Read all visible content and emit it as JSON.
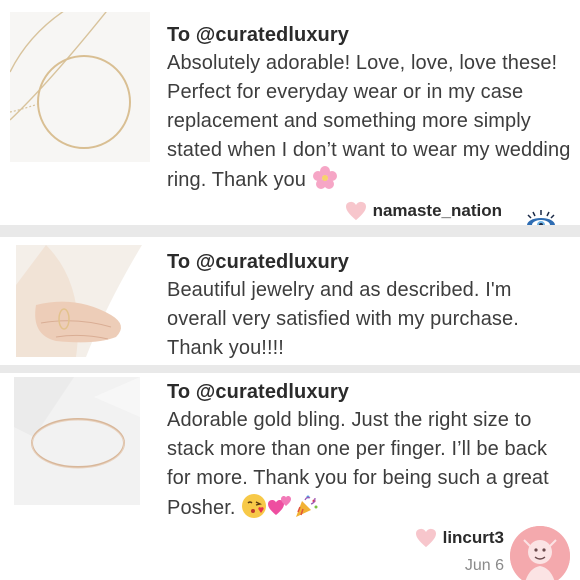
{
  "reviews": [
    {
      "to": "To @curatedluxury",
      "message": "Absolutely adorable! Love, love, love these! Perfect for everyday wear or in my case replacement and something more simply stated when I don’t want to wear my wedding ring. Thank you",
      "emoji_icons": [
        "cherry-blossom-icon"
      ],
      "username": "namaste_nation",
      "date": ""
    },
    {
      "to": "To @curatedluxury",
      "message": "Beautiful jewelry and as described. I'm overall very satisfied with my purchase. Thank you!!!!",
      "emoji_icons": [],
      "username": "",
      "date": ""
    },
    {
      "to": "To @curatedluxury",
      "message": "Adorable gold bling. Just the right size to stack more than one per finger. I’ll be back for more. Thank you for being such a great Posher.",
      "emoji_icons": [
        "face-blowing-kiss-icon",
        "two-hearts-icon",
        "party-popper-icon"
      ],
      "username": "lincurt3",
      "date": "Jun 6"
    }
  ],
  "colors": {
    "heart": "#f7c6cc",
    "avatar_bg": "#f4a9ad",
    "separator": "#e9e9e9",
    "text": "#3d3d3d"
  }
}
